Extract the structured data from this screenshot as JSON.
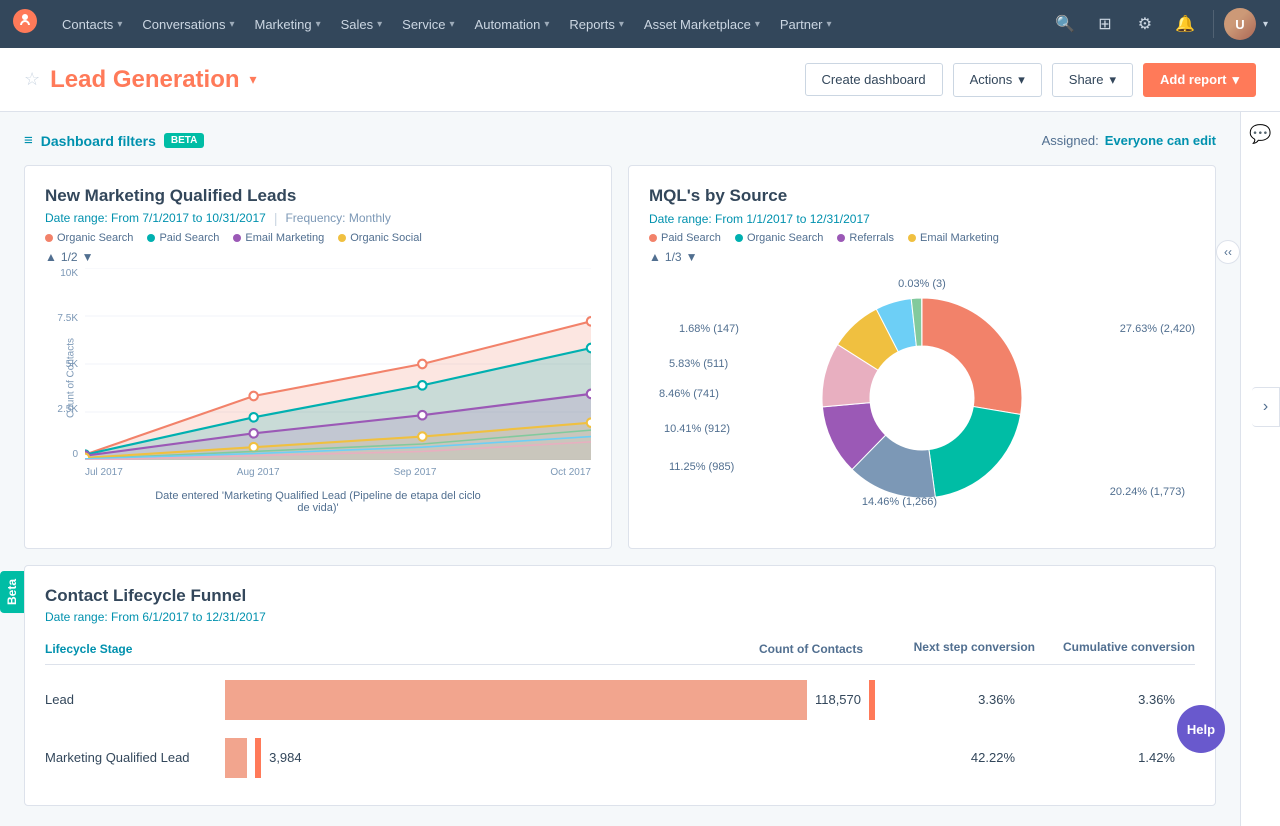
{
  "nav": {
    "logo": "●",
    "items": [
      {
        "label": "Contacts",
        "id": "contacts"
      },
      {
        "label": "Conversations",
        "id": "conversations"
      },
      {
        "label": "Marketing",
        "id": "marketing"
      },
      {
        "label": "Sales",
        "id": "sales"
      },
      {
        "label": "Service",
        "id": "service"
      },
      {
        "label": "Automation",
        "id": "automation"
      },
      {
        "label": "Reports",
        "id": "reports"
      },
      {
        "label": "Asset Marketplace",
        "id": "asset-marketplace"
      },
      {
        "label": "Partner",
        "id": "partner"
      }
    ]
  },
  "header": {
    "title": "Lead Generation",
    "create_dashboard": "Create dashboard",
    "actions": "Actions",
    "share": "Share",
    "add_report": "Add report"
  },
  "filters": {
    "label": "Dashboard filters",
    "beta": "BETA",
    "assigned_label": "Assigned:",
    "assigned_value": "Everyone can edit"
  },
  "mql_chart": {
    "title": "New Marketing Qualified Leads",
    "date_range": "Date range: From 7/1/2017 to 10/31/2017",
    "frequency": "Frequency: Monthly",
    "pagination": "1/2",
    "legend": [
      {
        "label": "Organic Search",
        "color": "#f2826a"
      },
      {
        "label": "Paid Search",
        "color": "#00b0b0"
      },
      {
        "label": "Email Marketing",
        "color": "#9b59b6"
      },
      {
        "label": "Organic Social",
        "color": "#f0c040"
      }
    ],
    "y_labels": [
      "10K",
      "7.5K",
      "5K",
      "2.5K",
      "0"
    ],
    "x_labels": [
      "Jul 2017",
      "Aug 2017",
      "Sep 2017",
      "Oct 2017"
    ],
    "axis_label": "Count of Contacts",
    "x_axis_label": "Date entered 'Marketing Qualified Lead (Pipeline de etapa del ciclo de vida)'"
  },
  "mql_source": {
    "title": "MQL's by Source",
    "date_range": "Date range: From 1/1/2017 to 12/31/2017",
    "pagination": "1/3",
    "legend": [
      {
        "label": "Paid Search",
        "color": "#f2826a"
      },
      {
        "label": "Organic Search",
        "color": "#00b0b0"
      },
      {
        "label": "Referrals",
        "color": "#9b59b6"
      },
      {
        "label": "Email Marketing",
        "color": "#f0c040"
      }
    ],
    "segments": [
      {
        "label": "27.63% (2,420)",
        "value": 27.63,
        "color": "#f2826a"
      },
      {
        "label": "20.24% (1,773)",
        "value": 20.24,
        "color": "#00bda5"
      },
      {
        "label": "14.46% (1,266)",
        "value": 14.46,
        "color": "#7c98b6"
      },
      {
        "label": "11.25% (985)",
        "value": 11.25,
        "color": "#9b59b6"
      },
      {
        "label": "10.41% (912)",
        "value": 10.41,
        "color": "#e8afc0"
      },
      {
        "label": "8.46% (741)",
        "value": 8.46,
        "color": "#f0c040"
      },
      {
        "label": "5.83% (511)",
        "value": 5.83,
        "color": "#6dcff6"
      },
      {
        "label": "1.68% (147)",
        "value": 1.68,
        "color": "#82ca9d"
      },
      {
        "label": "0.03% (3)",
        "value": 0.03,
        "color": "#8b5e3c"
      }
    ]
  },
  "funnel": {
    "title": "Contact Lifecycle Funnel",
    "date_range": "Date range: From 6/1/2017 to 12/31/2017",
    "col_lifecycle": "Lifecycle Stage",
    "col_count": "Count of Contacts",
    "col_next": "Next step conversion",
    "col_cumulative": "Cumulative conversion",
    "rows": [
      {
        "stage": "Lead",
        "count": "118,570",
        "bar_pct": 100,
        "next": "3.36%",
        "cumulative": "3.36%"
      },
      {
        "stage": "Marketing Qualified Lead",
        "count": "3,984",
        "bar_pct": 3.36,
        "next": "42.22%",
        "cumulative": "1.42%"
      }
    ]
  },
  "beta_tab": "Beta",
  "help_btn": "Help"
}
